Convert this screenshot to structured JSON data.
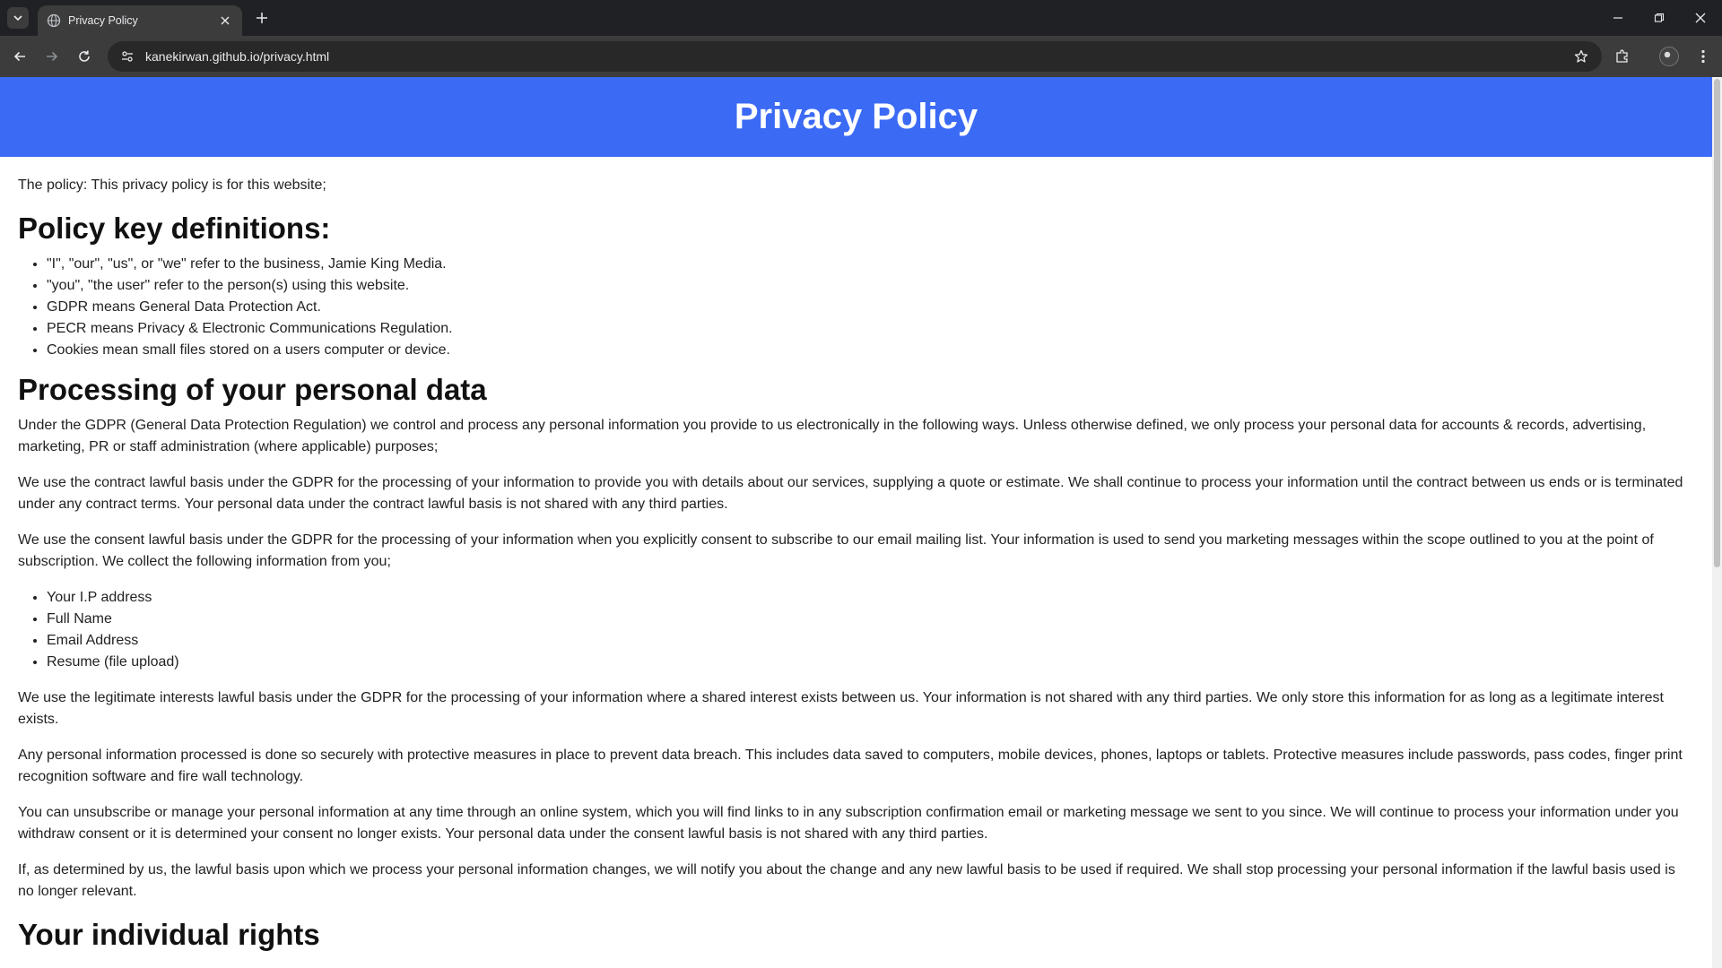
{
  "browser": {
    "tab_title": "Privacy Policy",
    "url": "kanekirwan.github.io/privacy.html"
  },
  "page": {
    "header_title": "Privacy Policy",
    "intro": "The policy: This privacy policy is for this website;",
    "definitions": {
      "heading": "Policy key definitions:",
      "items": [
        "\"I\", \"our\", \"us\", or \"we\" refer to the business, Jamie King Media.",
        "\"you\", \"the user\" refer to the person(s) using this website.",
        "GDPR means General Data Protection Act.",
        "PECR means Privacy & Electronic Communications Regulation.",
        "Cookies mean small files stored on a users computer or device."
      ]
    },
    "processing": {
      "heading": "Processing of your personal data",
      "p1": "Under the GDPR (General Data Protection Regulation) we control and process any personal information you provide to us electronically in the following ways. Unless otherwise defined, we only process your personal data for accounts & records, advertising, marketing, PR or staff administration (where applicable) purposes;",
      "p2": "We use the contract lawful basis under the GDPR for the processing of your information to provide you with details about our services, supplying a quote or estimate. We shall continue to process your information until the contract between us ends or is terminated under any contract terms. Your personal data under the contract lawful basis is not shared with any third parties.",
      "p3": "We use the consent lawful basis under the GDPR for the processing of your information when you explicitly consent to subscribe to our email mailing list. Your information is used to send you marketing messages within the scope outlined to you at the point of subscription. We collect the following information from you;",
      "collected": [
        "Your I.P address",
        "Full Name",
        "Email Address",
        "Resume (file upload)"
      ],
      "p4": "We use the legitimate interests lawful basis under the GDPR for the processing of your information where a shared interest exists between us. Your information is not shared with any third parties. We only store this information for as long as a legitimate interest exists.",
      "p5": "Any personal information processed is done so securely with protective measures in place to prevent data breach. This includes data saved to computers, mobile devices, phones, laptops or tablets. Protective measures include passwords, pass codes, finger print recognition software and fire wall technology.",
      "p6": "You can unsubscribe or manage your personal information at any time through an online system, which you will find links to in any subscription confirmation email or marketing message we sent to you since. We will continue to process your information under you withdraw consent or it is determined your consent no longer exists. Your personal data under the consent lawful basis is not shared with any third parties.",
      "p7": "If, as determined by us, the lawful basis upon which we process your personal information changes, we will notify you about the change and any new lawful basis to be used if required. We shall stop processing your personal information if the lawful basis used is no longer relevant."
    },
    "rights": {
      "heading": "Your individual rights"
    }
  },
  "colors": {
    "header_bg": "#3b6af5",
    "chrome_dark": "#202124",
    "toolbar": "#3c3c3c"
  }
}
